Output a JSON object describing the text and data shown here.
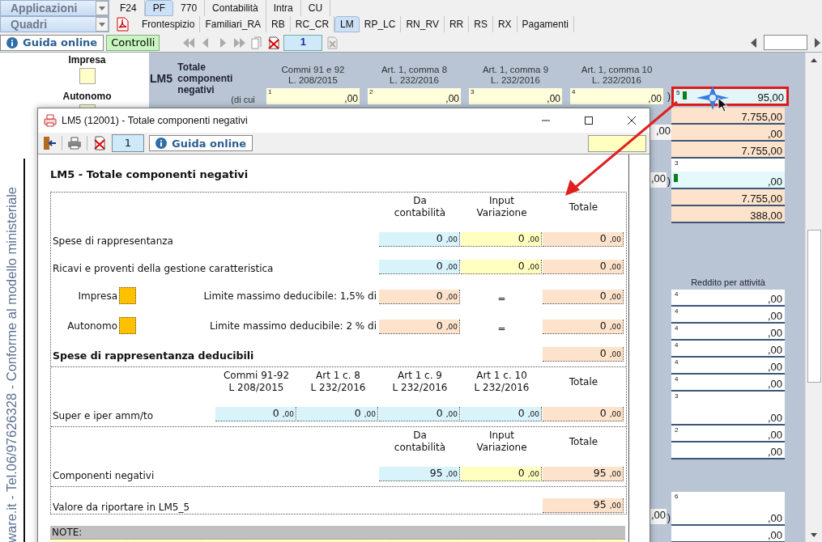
{
  "app_bar": {
    "dropdown": "Applicazioni",
    "tabs": [
      {
        "label": "F24",
        "selected": false
      },
      {
        "label": "PF",
        "selected": true
      },
      {
        "label": "770",
        "selected": false
      },
      {
        "label": "Contabilità",
        "selected": false
      },
      {
        "label": "Intra",
        "selected": false
      },
      {
        "label": "CU",
        "selected": false
      }
    ]
  },
  "section_bar": {
    "dropdown": "Quadri",
    "tabs": [
      {
        "label": "Frontespizio",
        "selected": false
      },
      {
        "label": "Familiari_RA",
        "selected": false
      },
      {
        "label": "RB",
        "selected": false
      },
      {
        "label": "RC_CR",
        "selected": false
      },
      {
        "label": "LM",
        "selected": true
      },
      {
        "label": "RP_LC",
        "selected": false
      },
      {
        "label": "RN_RV",
        "selected": false
      },
      {
        "label": "RR",
        "selected": false
      },
      {
        "label": "RS",
        "selected": false
      },
      {
        "label": "RX",
        "selected": false
      },
      {
        "label": "Pagamenti",
        "selected": false
      }
    ]
  },
  "toolbar": {
    "help_button": "Guida online",
    "check_button": "Controlli",
    "page": "1"
  },
  "side_panel": {
    "vertical_text": "ware.it - Tel.06/97626328 - Conforme al modello ministeriale",
    "options": [
      "Impresa",
      "Autonomo"
    ]
  },
  "form": {
    "code": "LM5",
    "title": "Totale componenti negativi",
    "of_which": "(di cui",
    "close_paren": ")",
    "columns": [
      {
        "heading": "Commi 91 e 92\nL. 208/2015",
        "number": "1",
        "value": ",00"
      },
      {
        "heading": "Art. 1, comma 8\nL. 232/2016",
        "number": "2",
        "value": ",00"
      },
      {
        "heading": "Art. 1, comma 9\nL. 232/2016",
        "number": "3",
        "value": ",00"
      },
      {
        "heading": "Art. 1, comma 10\nL. 232/2016",
        "number": "4",
        "value": ",00"
      }
    ],
    "total": {
      "number": "5",
      "value": "95,00",
      "marked": true,
      "highlighted": true
    },
    "upper_rows": [
      {
        "kind": "computed",
        "value": "7.755,00",
        "marked": false
      },
      {
        "kind": "computed",
        "value": ",00",
        "marked": false,
        "side": ",00"
      },
      {
        "kind": "computed",
        "value": "7.755,00",
        "marked": false
      },
      {
        "kind": "entry",
        "number": "3",
        "value": ",00",
        "marked": true,
        "side": ",00",
        "side_paren": ")"
      },
      {
        "kind": "computed",
        "value": "7.755,00",
        "marked": false
      },
      {
        "kind": "computed",
        "value": "388,00",
        "marked": false
      }
    ],
    "income_heading": "Reddito per attività",
    "income_rows": [
      {
        "kind": "plain",
        "number": "4",
        "value": ",00"
      },
      {
        "kind": "plain",
        "number": "4",
        "value": ",00"
      },
      {
        "kind": "plain",
        "number": "4",
        "value": ",00"
      },
      {
        "kind": "plain",
        "number": "4",
        "value": ",00"
      },
      {
        "kind": "plain",
        "number": "4",
        "value": ",00"
      },
      {
        "kind": "plain",
        "number": "4",
        "value": ",00"
      },
      {
        "kind": "tall",
        "number": "3",
        "value": ",00"
      },
      {
        "kind": "plain",
        "number": "2",
        "value": ",00"
      },
      {
        "kind": "plain",
        "value": ",00"
      }
    ],
    "lower_rows": [
      {
        "kind": "tall",
        "number": "6",
        "value": ",00",
        "side": ",00",
        "side_paren": ")"
      },
      {
        "kind": "plain",
        "value": ",00"
      }
    ]
  },
  "dialog": {
    "title": "LM5 (12001) - Totale componenti negativi",
    "page": "1",
    "help_button": "Guida online",
    "heading": "LM5 - Totale componenti negativi",
    "note_label": "NOTE:",
    "sections": [
      {
        "headers": [
          "Da\ncontabilità",
          "Input\nVariazione",
          "Totale"
        ],
        "rows": [
          {
            "kind": "fields",
            "label": "Spese di rappresentanza",
            "fields": [
              {
                "kind": "entry",
                "value": "0",
                "cents": ",00"
              },
              {
                "kind": "variation",
                "value": "0",
                "cents": ",00"
              },
              {
                "kind": "computed",
                "value": "0",
                "cents": ",00"
              }
            ]
          },
          {
            "kind": "fields",
            "label": "Ricavi e proventi della gestione caratteristica",
            "fields": [
              {
                "kind": "entry",
                "value": "0",
                "cents": ",00"
              },
              {
                "kind": "variation",
                "value": "0",
                "cents": ",00"
              },
              {
                "kind": "computed",
                "value": "0",
                "cents": ",00"
              }
            ]
          },
          {
            "kind": "limit",
            "option": "Impresa",
            "label": "Limite massimo deducibile: 1,5% di",
            "equals": "=",
            "fields": [
              {
                "kind": "computed",
                "value": "0",
                "cents": ",00"
              },
              {
                "kind": "computed",
                "value": "0",
                "cents": ",00"
              }
            ]
          },
          {
            "kind": "limit",
            "option": "Autonomo",
            "label": "Limite massimo deducibile: 2 % di",
            "equals": "=",
            "fields": [
              {
                "kind": "computed",
                "value": "0",
                "cents": ",00"
              },
              {
                "kind": "computed",
                "value": "0",
                "cents": ",00"
              }
            ]
          },
          {
            "kind": "total",
            "label": "Spese di rappresentanza deducibili",
            "fields": [
              {
                "kind": "computed",
                "value": "0",
                "cents": ",00"
              }
            ]
          }
        ]
      },
      {
        "headers": [
          "Commi 91-92\nL 208/2015",
          "Art 1 c. 8\nL 232/2016",
          "Art 1 c. 9\nL 232/2016",
          "Art 1 c. 10\nL 232/2016",
          "Totale"
        ],
        "rows": [
          {
            "kind": "fields",
            "label": "Super e iper amm/to",
            "fields": [
              {
                "kind": "entry",
                "value": "0",
                "cents": ",00"
              },
              {
                "kind": "entry",
                "value": "0",
                "cents": ",00"
              },
              {
                "kind": "entry",
                "value": "0",
                "cents": ",00"
              },
              {
                "kind": "entry",
                "value": "0",
                "cents": ",00"
              },
              {
                "kind": "computed",
                "value": "0",
                "cents": ",00"
              }
            ]
          }
        ]
      },
      {
        "headers": [
          "Da\ncontabilità",
          "Input\nVariazione",
          "Totale"
        ],
        "rows": [
          {
            "kind": "fields",
            "label": "Componenti negativi",
            "fields": [
              {
                "kind": "entry",
                "value": "95",
                "cents": ",00"
              },
              {
                "kind": "variation",
                "value": "0",
                "cents": ",00"
              },
              {
                "kind": "computed",
                "value": "95",
                "cents": ",00"
              }
            ]
          }
        ]
      },
      {
        "rows": [
          {
            "kind": "fields",
            "label": "Valore da riportare in LM5_5",
            "fields": [
              {
                "kind": "computed",
                "value": "95",
                "cents": ",00"
              }
            ]
          }
        ]
      }
    ]
  }
}
